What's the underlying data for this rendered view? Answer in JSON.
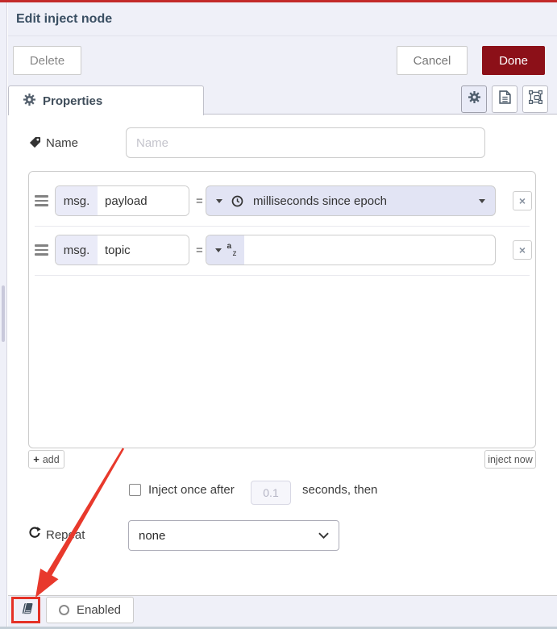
{
  "window": {
    "title": "Edit inject node"
  },
  "toolbar": {
    "delete_label": "Delete",
    "cancel_label": "Cancel",
    "done_label": "Done"
  },
  "tabs": {
    "properties_label": "Properties"
  },
  "form": {
    "name_label": "Name",
    "name_placeholder": "Name",
    "eq": "=",
    "props": [
      {
        "prefix": "msg.",
        "field": "payload",
        "type": "timestamp",
        "type_value": "milliseconds since epoch"
      },
      {
        "prefix": "msg.",
        "field": "topic",
        "type": "string",
        "type_value": ""
      }
    ],
    "add_label": "add",
    "inject_now_label": "inject now",
    "once_before": "Inject once after",
    "once_value": "0.1",
    "once_after": "seconds, then",
    "repeat_label": "Repeat",
    "repeat_value": "none"
  },
  "footer": {
    "enabled_label": "Enabled"
  },
  "colors": {
    "done_red": "#8C101C",
    "annotation_red": "#E53125",
    "panel_lavender": "#EFF0F8",
    "typed_lavender": "#E2E4F4"
  }
}
